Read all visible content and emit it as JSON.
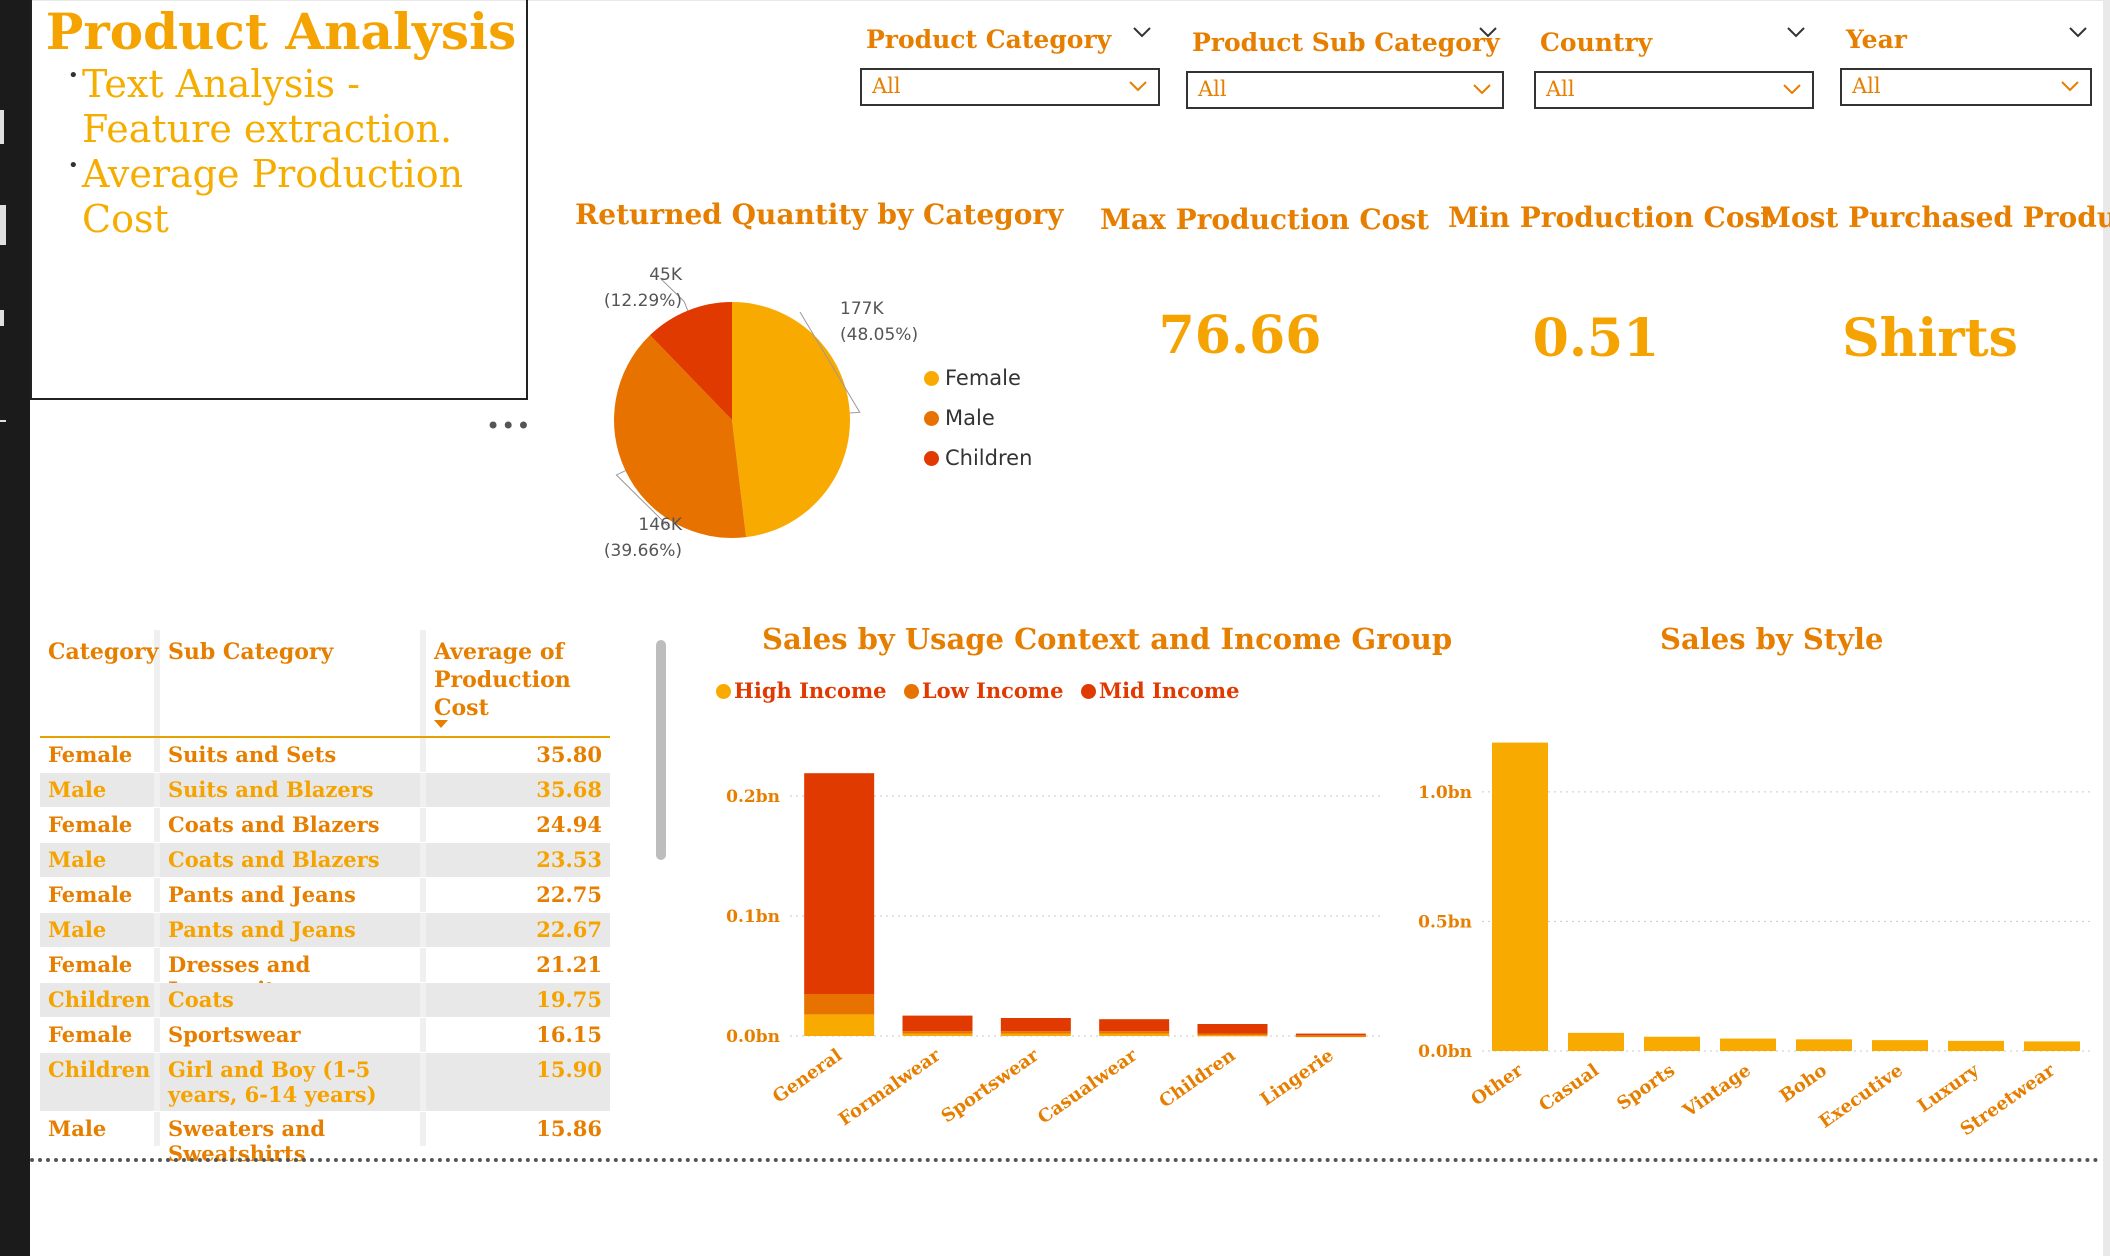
{
  "text_box": {
    "title": "Product Analysis",
    "bullets": [
      "Text Analysis - Feature extraction.",
      "Average Production Cost"
    ],
    "more_label": "•••"
  },
  "slicers": [
    {
      "label": "Product Category",
      "value": "All"
    },
    {
      "label": "Product Sub Category",
      "value": "All"
    },
    {
      "label": "Country",
      "value": "All"
    },
    {
      "label": "Year",
      "value": "All"
    }
  ],
  "pie": {
    "title": "Returned Quantity by Category",
    "legend": [
      "Female",
      "Male",
      "Children"
    ],
    "colors": {
      "Female": "#f9aa00",
      "Male": "#e87200",
      "Children": "#e03a00"
    },
    "labels": {
      "female_value": "177K",
      "female_pct": "(48.05%)",
      "male_value": "146K",
      "male_pct": "(39.66%)",
      "children_value": "45K",
      "children_pct": "(12.29%)"
    }
  },
  "kpis": [
    {
      "title": "Max Production Cost",
      "value": "76.66"
    },
    {
      "title": "Min Production Cost",
      "value": "0.51"
    },
    {
      "title": "Most Purchased Product",
      "value": "Shirts"
    }
  ],
  "table": {
    "headers": [
      "Category",
      "Sub Category",
      "Average of Production Cost"
    ],
    "rows": [
      {
        "category": "Female",
        "sub_category": "Suits and Sets",
        "avg_cost": "35.80"
      },
      {
        "category": "Male",
        "sub_category": "Suits and Blazers",
        "avg_cost": "35.68"
      },
      {
        "category": "Female",
        "sub_category": "Coats and Blazers",
        "avg_cost": "24.94"
      },
      {
        "category": "Male",
        "sub_category": "Coats and Blazers",
        "avg_cost": "23.53"
      },
      {
        "category": "Female",
        "sub_category": "Pants and Jeans",
        "avg_cost": "22.75"
      },
      {
        "category": "Male",
        "sub_category": "Pants and Jeans",
        "avg_cost": "22.67"
      },
      {
        "category": "Female",
        "sub_category": "Dresses and Jumpsuits",
        "avg_cost": "21.21"
      },
      {
        "category": "Children",
        "sub_category": "Coats",
        "avg_cost": "19.75"
      },
      {
        "category": "Female",
        "sub_category": "Sportswear",
        "avg_cost": "16.15"
      },
      {
        "category": "Children",
        "sub_category": "Girl and Boy (1-5 years, 6-14 years)",
        "avg_cost": "15.90"
      },
      {
        "category": "Male",
        "sub_category": "Sweaters and Sweatshirts",
        "avg_cost": "15.86"
      }
    ]
  },
  "chart_data": [
    {
      "type": "pie",
      "title": "Returned Quantity by Category",
      "categories": [
        "Female",
        "Male",
        "Children"
      ],
      "values": [
        177000,
        146000,
        45000
      ],
      "percentages": [
        48.05,
        39.66,
        12.29
      ],
      "legend": "right"
    },
    {
      "type": "bar",
      "stacked": true,
      "title": "Sales by Usage Context and Income Group",
      "categories": [
        "General",
        "Formalwear",
        "Sportswear",
        "Casualwear",
        "Children",
        "Lingerie"
      ],
      "series": [
        {
          "name": "High Income",
          "color": "#f9aa00",
          "values": [
            0.018,
            0.002,
            0.002,
            0.002,
            0.001,
            0.0003
          ]
        },
        {
          "name": "Low Income",
          "color": "#e87200",
          "values": [
            0.017,
            0.002,
            0.002,
            0.002,
            0.001,
            0.0003
          ]
        },
        {
          "name": "Mid Income",
          "color": "#e03a00",
          "values": [
            0.184,
            0.013,
            0.011,
            0.01,
            0.008,
            0.0014
          ]
        }
      ],
      "ylim": [
        0,
        0.23
      ],
      "yticks": [
        "0.0bn",
        "0.1bn",
        "0.2bn"
      ],
      "legend": "top-left",
      "grid": true
    },
    {
      "type": "bar",
      "title": "Sales by Style",
      "categories": [
        "Other",
        "Casual",
        "Sports",
        "Vintage",
        "Boho",
        "Executive",
        "Luxury",
        "Streetwear"
      ],
      "series": [
        {
          "color": "#f9aa00",
          "values": [
            1.19,
            0.07,
            0.055,
            0.048,
            0.045,
            0.042,
            0.039,
            0.037
          ]
        }
      ],
      "ylim": [
        0,
        1.2
      ],
      "yticks": [
        "0.0bn",
        "0.5bn",
        "1.0bn"
      ],
      "grid": true
    }
  ]
}
